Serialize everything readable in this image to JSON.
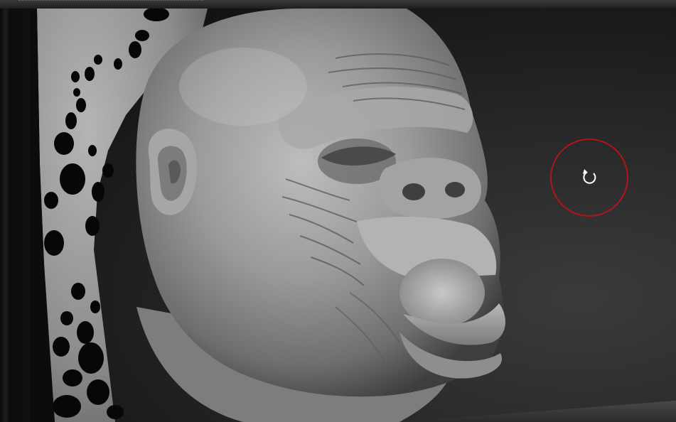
{
  "window": {
    "title": ""
  },
  "viewport": {
    "model": "gorilla-head-sculpt",
    "background_color": "#262626",
    "material_color": "#9c9c9c"
  },
  "cursor": {
    "icon": "rotate-icon",
    "ring_color": "#b3141a"
  }
}
